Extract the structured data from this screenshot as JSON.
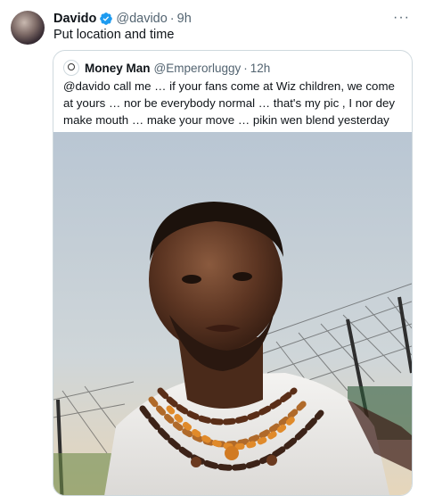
{
  "tweet": {
    "author_name": "Davido",
    "author_handle": "@davido",
    "time": "9h",
    "separator": "·",
    "more_label": "···",
    "text": "Put location and time"
  },
  "quoted": {
    "author_name": "Money Man",
    "author_handle": "@Emperorluggy",
    "separator": "·",
    "time": "12h",
    "text": "@davido call me … if your fans come at Wiz children, we come at yours … nor be everybody normal … that's my pic , I nor dey make mouth … make your move … pikin wen blend yesterday nor fit follow me rake !!!"
  },
  "colors": {
    "verified": "#1d9bf0",
    "secondary_text": "#536471",
    "border": "#cfd9de"
  },
  "icons": {
    "verified": "verified-badge-icon",
    "more": "more-horizontal-icon"
  }
}
